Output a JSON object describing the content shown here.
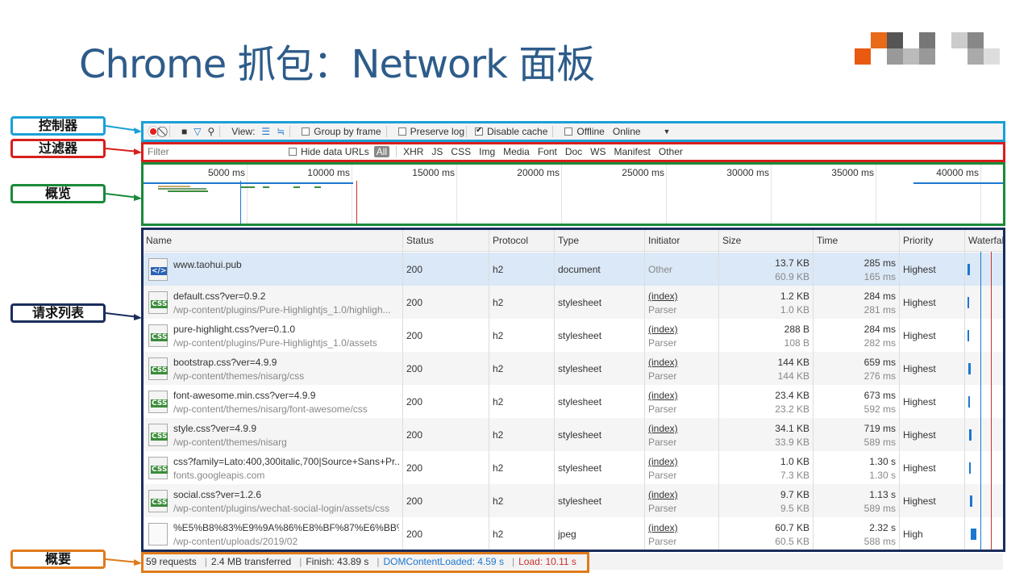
{
  "slide": {
    "title": "Chrome 抓包：Network 面板"
  },
  "callouts": {
    "controller": "控制器",
    "filter": "过滤器",
    "overview": "概览",
    "request_list": "请求列表",
    "summary": "概要"
  },
  "colors": {
    "controller": "#1aa0d8",
    "filter": "#d81e1e",
    "overview": "#1a8a3a",
    "request_list": "#1a2e5c",
    "summary": "#e07a1a",
    "title": "#2e5c8a"
  },
  "toolbar": {
    "record_icon": "record-icon",
    "clear_icon": "clear-icon",
    "view_label": "View:",
    "group_by_frame": "Group by frame",
    "preserve_log": "Preserve log",
    "disable_cache": "Disable cache",
    "offline": "Offline",
    "throttle": "Online"
  },
  "filterbar": {
    "placeholder": "Filter",
    "hide_data_urls": "Hide data URLs",
    "types": [
      "All",
      "XHR",
      "JS",
      "CSS",
      "Img",
      "Media",
      "Font",
      "Doc",
      "WS",
      "Manifest",
      "Other"
    ]
  },
  "overview": {
    "ticks": [
      "5000 ms",
      "10000 ms",
      "15000 ms",
      "20000 ms",
      "25000 ms",
      "30000 ms",
      "35000 ms",
      "40000 ms"
    ]
  },
  "table": {
    "headers": [
      "Name",
      "Status",
      "Protocol",
      "Type",
      "Initiator",
      "Size",
      "Time",
      "Priority",
      "Waterfall"
    ],
    "rows": [
      {
        "icon": "doc",
        "name": "www.taohui.pub",
        "path": "",
        "status": "200",
        "protocol": "h2",
        "type": "document",
        "initiator": "Other",
        "initiator_sub": "",
        "size": "13.7 KB",
        "size_sub": "60.9 KB",
        "time": "285 ms",
        "time_sub": "165 ms",
        "priority": "Highest"
      },
      {
        "icon": "css",
        "name": "default.css?ver=0.9.2",
        "path": "/wp-content/plugins/Pure-Highlightjs_1.0/highligh...",
        "status": "200",
        "protocol": "h2",
        "type": "stylesheet",
        "initiator": "(index)",
        "initiator_sub": "Parser",
        "size": "1.2 KB",
        "size_sub": "1.0 KB",
        "time": "284 ms",
        "time_sub": "281 ms",
        "priority": "Highest"
      },
      {
        "icon": "css",
        "name": "pure-highlight.css?ver=0.1.0",
        "path": "/wp-content/plugins/Pure-Highlightjs_1.0/assets",
        "status": "200",
        "protocol": "h2",
        "type": "stylesheet",
        "initiator": "(index)",
        "initiator_sub": "Parser",
        "size": "288 B",
        "size_sub": "108 B",
        "time": "284 ms",
        "time_sub": "282 ms",
        "priority": "Highest"
      },
      {
        "icon": "css",
        "name": "bootstrap.css?ver=4.9.9",
        "path": "/wp-content/themes/nisarg/css",
        "status": "200",
        "protocol": "h2",
        "type": "stylesheet",
        "initiator": "(index)",
        "initiator_sub": "Parser",
        "size": "144 KB",
        "size_sub": "144 KB",
        "time": "659 ms",
        "time_sub": "276 ms",
        "priority": "Highest"
      },
      {
        "icon": "css",
        "name": "font-awesome.min.css?ver=4.9.9",
        "path": "/wp-content/themes/nisarg/font-awesome/css",
        "status": "200",
        "protocol": "h2",
        "type": "stylesheet",
        "initiator": "(index)",
        "initiator_sub": "Parser",
        "size": "23.4 KB",
        "size_sub": "23.2 KB",
        "time": "673 ms",
        "time_sub": "592 ms",
        "priority": "Highest"
      },
      {
        "icon": "css",
        "name": "style.css?ver=4.9.9",
        "path": "/wp-content/themes/nisarg",
        "status": "200",
        "protocol": "h2",
        "type": "stylesheet",
        "initiator": "(index)",
        "initiator_sub": "Parser",
        "size": "34.1 KB",
        "size_sub": "33.9 KB",
        "time": "719 ms",
        "time_sub": "589 ms",
        "priority": "Highest"
      },
      {
        "icon": "css",
        "name": "css?family=Lato:400,300italic,700|Source+Sans+Pr...",
        "path": "fonts.googleapis.com",
        "status": "200",
        "protocol": "h2",
        "type": "stylesheet",
        "initiator": "(index)",
        "initiator_sub": "Parser",
        "size": "1.0 KB",
        "size_sub": "7.3 KB",
        "time": "1.30 s",
        "time_sub": "1.30 s",
        "priority": "Highest"
      },
      {
        "icon": "css",
        "name": "social.css?ver=1.2.6",
        "path": "/wp-content/plugins/wechat-social-login/assets/css",
        "status": "200",
        "protocol": "h2",
        "type": "stylesheet",
        "initiator": "(index)",
        "initiator_sub": "Parser",
        "size": "9.7 KB",
        "size_sub": "9.5 KB",
        "time": "1.13 s",
        "time_sub": "589 ms",
        "priority": "Highest"
      },
      {
        "icon": "img",
        "name": "%E5%B8%83%E9%9A%86%E8%BF%87%E6%BB%A...",
        "path": "/wp-content/uploads/2019/02",
        "status": "200",
        "protocol": "h2",
        "type": "jpeg",
        "initiator": "(index)",
        "initiator_sub": "Parser",
        "size": "60.7 KB",
        "size_sub": "60.5 KB",
        "time": "2.32 s",
        "time_sub": "588 ms",
        "priority": "High"
      }
    ]
  },
  "summary": {
    "requests": "59 requests",
    "transferred": "2.4 MB transferred",
    "finish": "Finish: 43.89 s",
    "dom_loaded": "DOMContentLoaded: 4.59 s",
    "load": "Load: 10.11 s"
  }
}
